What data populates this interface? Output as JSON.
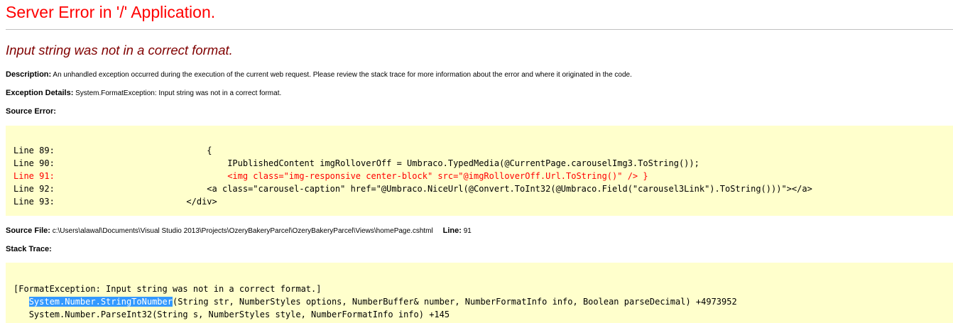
{
  "page_title": "Server Error in '/' Application.",
  "error_message": "Input string was not in a correct format.",
  "description": {
    "label": "Description:",
    "text": "An unhandled exception occurred during the execution of the current web request. Please review the stack trace for more information about the error and where it originated in the code."
  },
  "exception_details": {
    "label": "Exception Details:",
    "text": "System.FormatException: Input string was not in a correct format."
  },
  "source_error": {
    "label": "Source Error:",
    "lines": [
      {
        "num": "Line 89:",
        "code": "                            {",
        "highlight": false
      },
      {
        "num": "Line 90:",
        "code": "                                IPublishedContent imgRolloverOff = Umbraco.TypedMedia(@CurrentPage.carouselImg3.ToString());",
        "highlight": false
      },
      {
        "num": "Line 91:",
        "code": "                                <img class=\"img-responsive center-block\" src=\"@imgRolloverOff.Url.ToString()\" /> }",
        "highlight": true
      },
      {
        "num": "Line 92:",
        "code": "                            <a class=\"carousel-caption\" href=\"@Umbraco.NiceUrl(@Convert.ToInt32(@Umbraco.Field(\"carousel3Link\").ToString()))\"></a>",
        "highlight": false
      },
      {
        "num": "Line 93:",
        "code": "                        </div>",
        "highlight": false
      }
    ]
  },
  "source_file": {
    "label": "Source File:",
    "path": "c:\\Users\\alawal\\Documents\\Visual Studio 2013\\Projects\\OzeryBakeryParcel\\OzeryBakeryParcel\\Views\\homePage.cshtml",
    "line_label": "Line:",
    "line_value": "91"
  },
  "stack_trace": {
    "label": "Stack Trace:",
    "header": "[FormatException: Input string was not in a correct format.]",
    "frame1_selected": "System.Number.StringToNumber",
    "frame1_rest": "(String str, NumberStyles options, NumberBuffer& number, NumberFormatInfo info, Boolean parseDecimal) +4973952",
    "frame2": "System.Number.ParseInt32(String s, NumberStyles style, NumberFormatInfo info) +145"
  },
  "colors": {
    "title": "#ff0000",
    "error_message": "#800000",
    "code_background": "#ffffcc",
    "highlight_line": "#ff0000",
    "selection": "#3399ff"
  }
}
